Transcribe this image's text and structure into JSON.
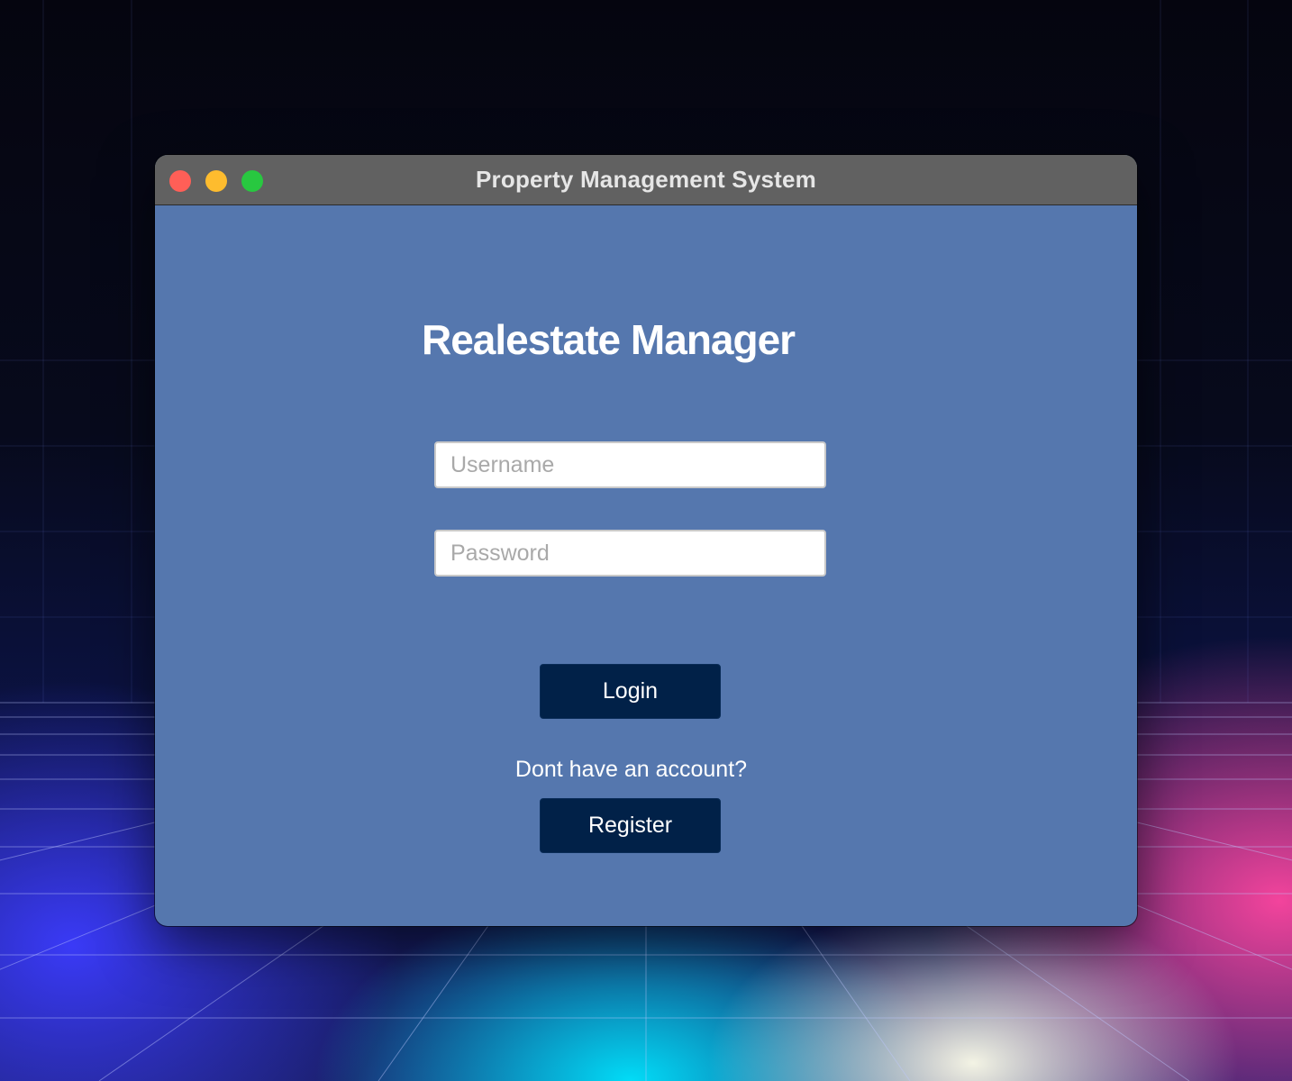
{
  "window": {
    "title": "Property Management System",
    "controls": [
      "close",
      "minimize",
      "zoom"
    ]
  },
  "app": {
    "heading": "Realestate Manager"
  },
  "form": {
    "username_placeholder": "Username",
    "username_value": "",
    "password_placeholder": "Password",
    "password_value": "",
    "login_label": "Login",
    "register_prompt": "Dont have an account?",
    "register_label": "Register"
  },
  "colors": {
    "window_background": "#5577ae",
    "titlebar": "#616161",
    "button": "#012148",
    "close": "#ff5f57",
    "minimize": "#febc2e",
    "zoom": "#28c840"
  }
}
